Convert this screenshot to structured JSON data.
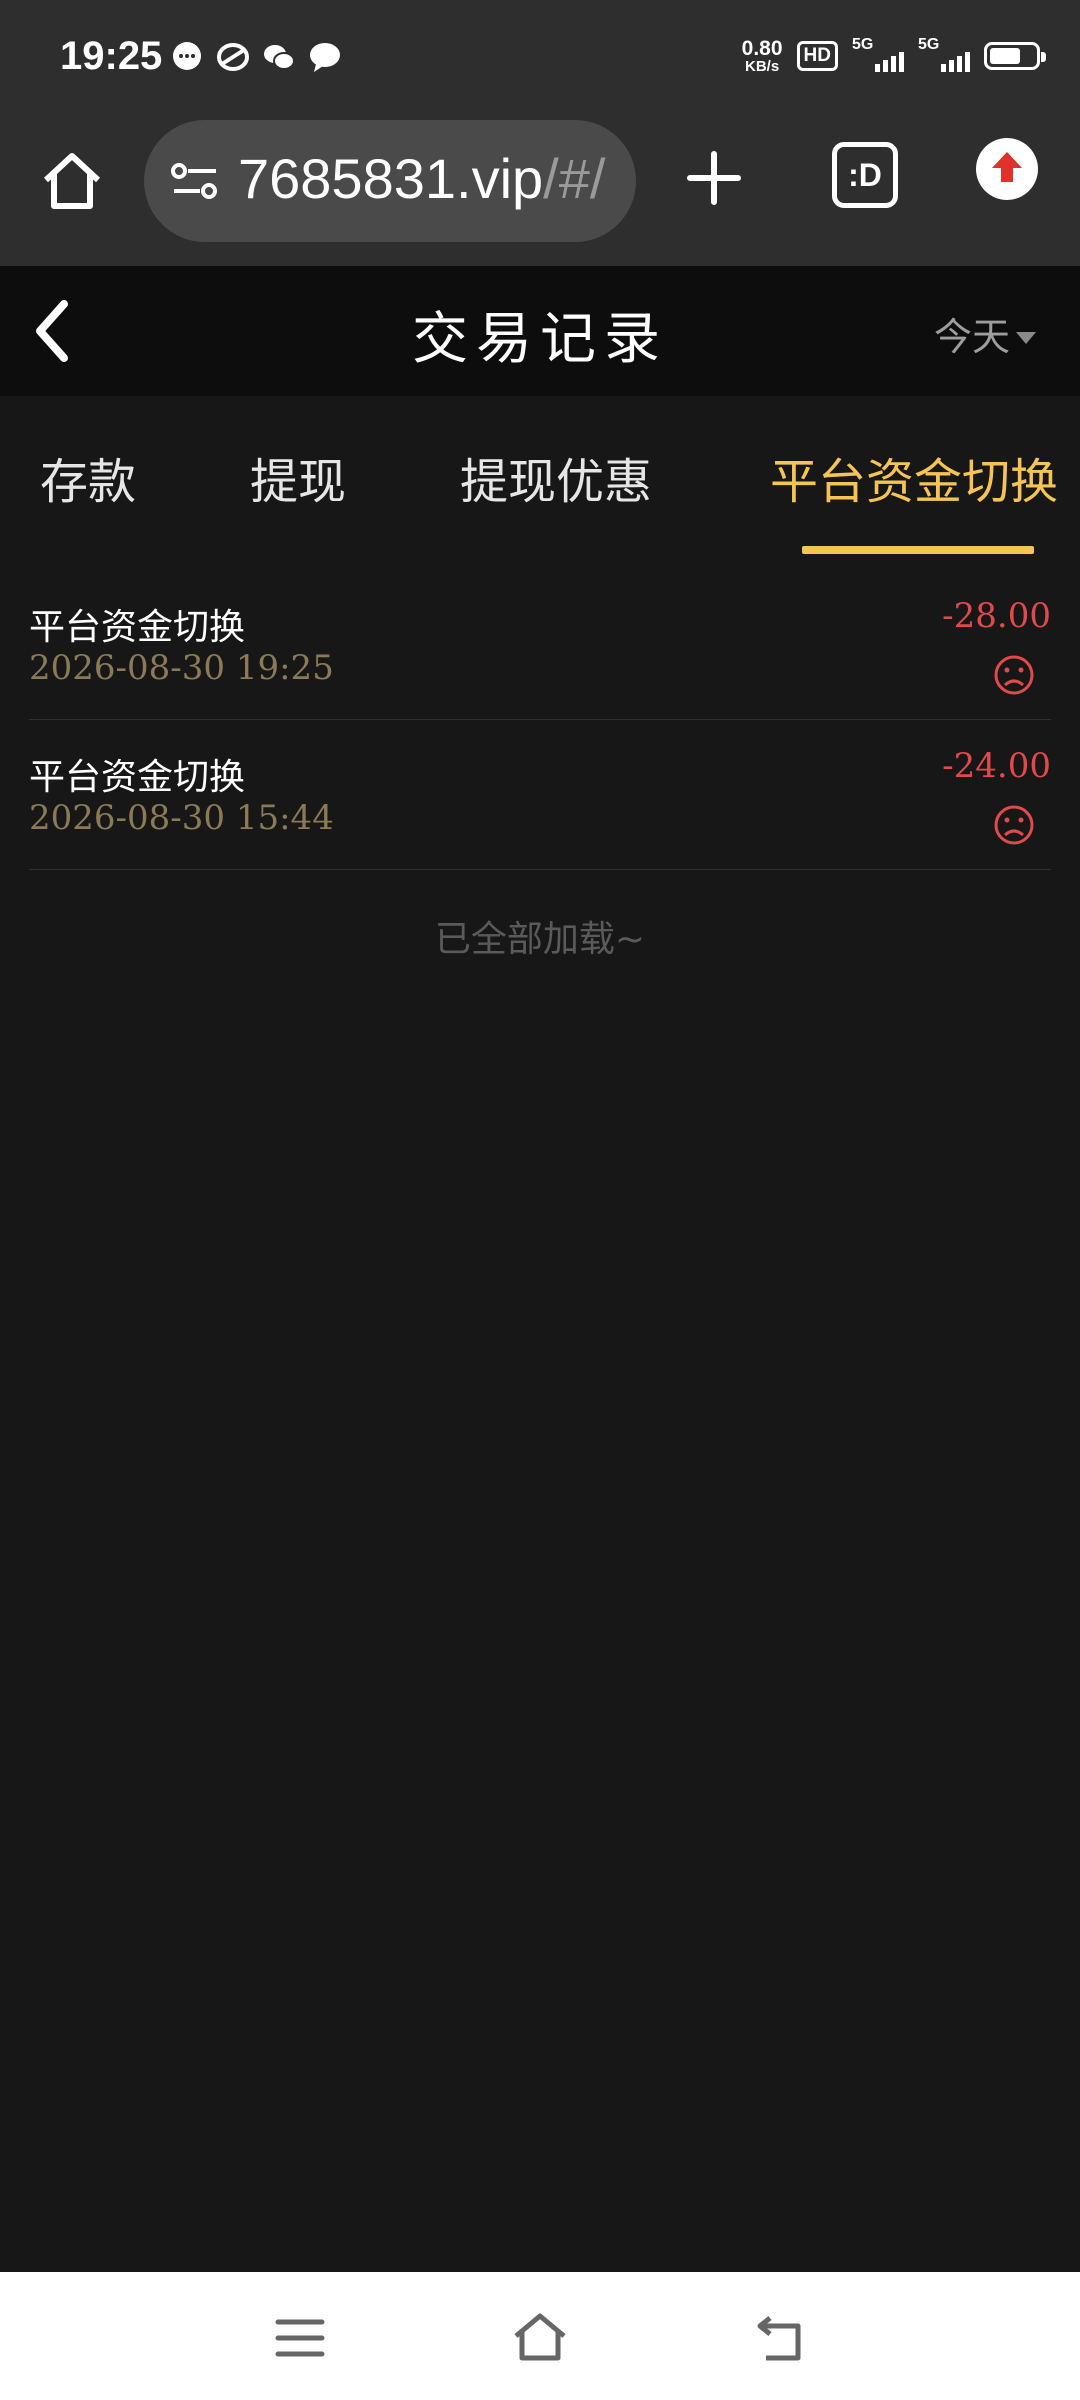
{
  "status_bar": {
    "time": "19:25",
    "notifications": [
      "message-icon",
      "app-icon",
      "wechat-icon",
      "chat-icon"
    ],
    "net_speed_value": "0.80",
    "net_speed_unit": "KB/s",
    "hd": "HD",
    "sim1": "5G",
    "sim2": "5G",
    "battery_level": 0.6
  },
  "browser": {
    "url_host": "7685831.vip",
    "url_rest": "/#/",
    "tabs_label": ":D"
  },
  "header": {
    "title": "交易记录",
    "date_filter": "今天"
  },
  "tabs": [
    {
      "label": "存款",
      "active": false
    },
    {
      "label": "提现",
      "active": false
    },
    {
      "label": "提现优惠",
      "active": false
    },
    {
      "label": "平台资金切换",
      "active": true
    }
  ],
  "records": [
    {
      "type": "平台资金切换",
      "time": "2026-08-30 19:25",
      "amount": "-28.00",
      "status_icon": "sad-face-icon"
    },
    {
      "type": "平台资金切换",
      "time": "2026-08-30 15:44",
      "amount": "-24.00",
      "status_icon": "sad-face-icon"
    }
  ],
  "list_end_text": "已全部加载~",
  "colors": {
    "accent": "#f6c452",
    "negative": "#e04a4a",
    "background": "#171717"
  }
}
